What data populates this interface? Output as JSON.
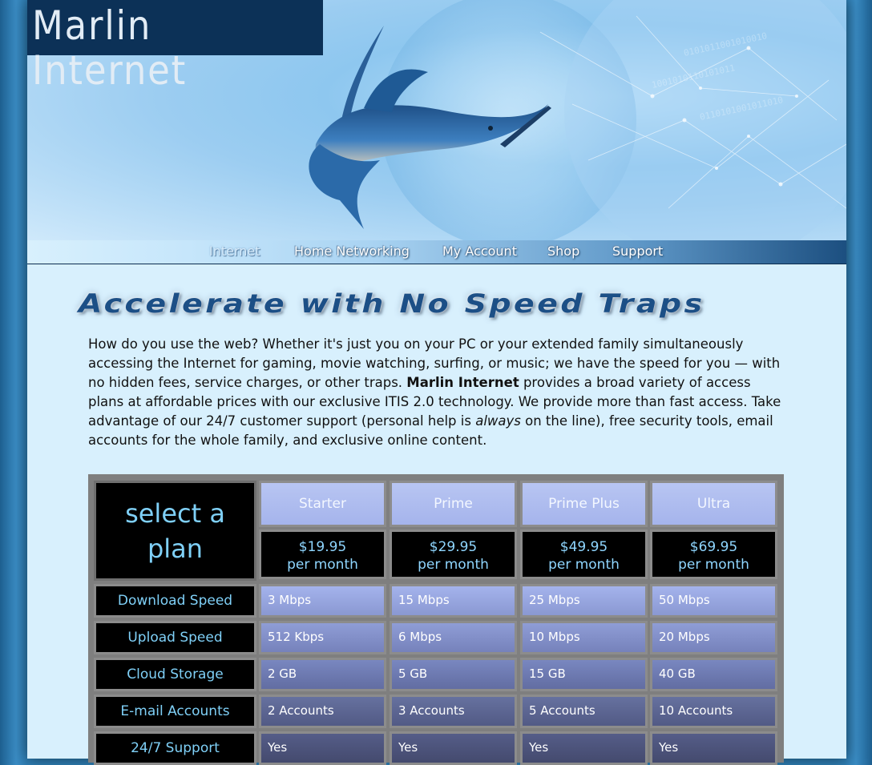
{
  "brand": {
    "logo_text": "Marlin Internet"
  },
  "nav": {
    "items": [
      {
        "label": "Internet",
        "active": true
      },
      {
        "label": "Home Networking"
      },
      {
        "label": "My Account"
      },
      {
        "label": "Shop"
      },
      {
        "label": "Support"
      }
    ]
  },
  "main": {
    "headline": "Accelerate with No Speed Traps",
    "intro": {
      "part1": "How do you use the web? Whether it's just you on your PC or your extended family simultaneously accessing the Internet for gaming, movie watching, surfing, or music; we have the speed for you — with no hidden fees, service charges, or other traps. ",
      "brand_bold": "Marlin Internet",
      "part2": " provides a broad variety of access plans at affordable prices with our exclusive ITIS 2.0 technology. We provide more than fast access. Take advantage of our 24/7 customer support (personal help is ",
      "emphasis": "always",
      "part3": " on the line), free security tools, email accounts for the whole family, and exclusive online content."
    }
  },
  "plans_table": {
    "corner_label": "select a plan",
    "plans": [
      {
        "name": "Starter",
        "price": "$19.95",
        "period": "per month"
      },
      {
        "name": "Prime",
        "price": "$29.95",
        "period": "per month"
      },
      {
        "name": "Prime Plus",
        "price": "$49.95",
        "period": "per month"
      },
      {
        "name": "Ultra",
        "price": "$69.95",
        "period": "per month"
      }
    ],
    "rows": [
      {
        "label": "Download Speed",
        "values": [
          "3 Mbps",
          "15 Mbps",
          "25 Mbps",
          "50 Mbps"
        ]
      },
      {
        "label": "Upload Speed",
        "values": [
          "512 Kbps",
          "6 Mbps",
          "10 Mbps",
          "20 Mbps"
        ]
      },
      {
        "label": "Cloud Storage",
        "values": [
          "2 GB",
          "5 GB",
          "15 GB",
          "40 GB"
        ]
      },
      {
        "label": "E-mail Accounts",
        "values": [
          "2 Accounts",
          "3 Accounts",
          "5 Accounts",
          "10 Accounts"
        ]
      },
      {
        "label": "24/7 Support",
        "values": [
          "Yes",
          "Yes",
          "Yes",
          "Yes"
        ]
      }
    ]
  },
  "colors": {
    "page_bg": "#d8f0fd",
    "logo_bg": "#0c3157",
    "table_frame": "#7f7f7f",
    "label_text": "#7fd0f7"
  },
  "icons": [
    "marlin-logo-illustration",
    "globe-network-background"
  ]
}
